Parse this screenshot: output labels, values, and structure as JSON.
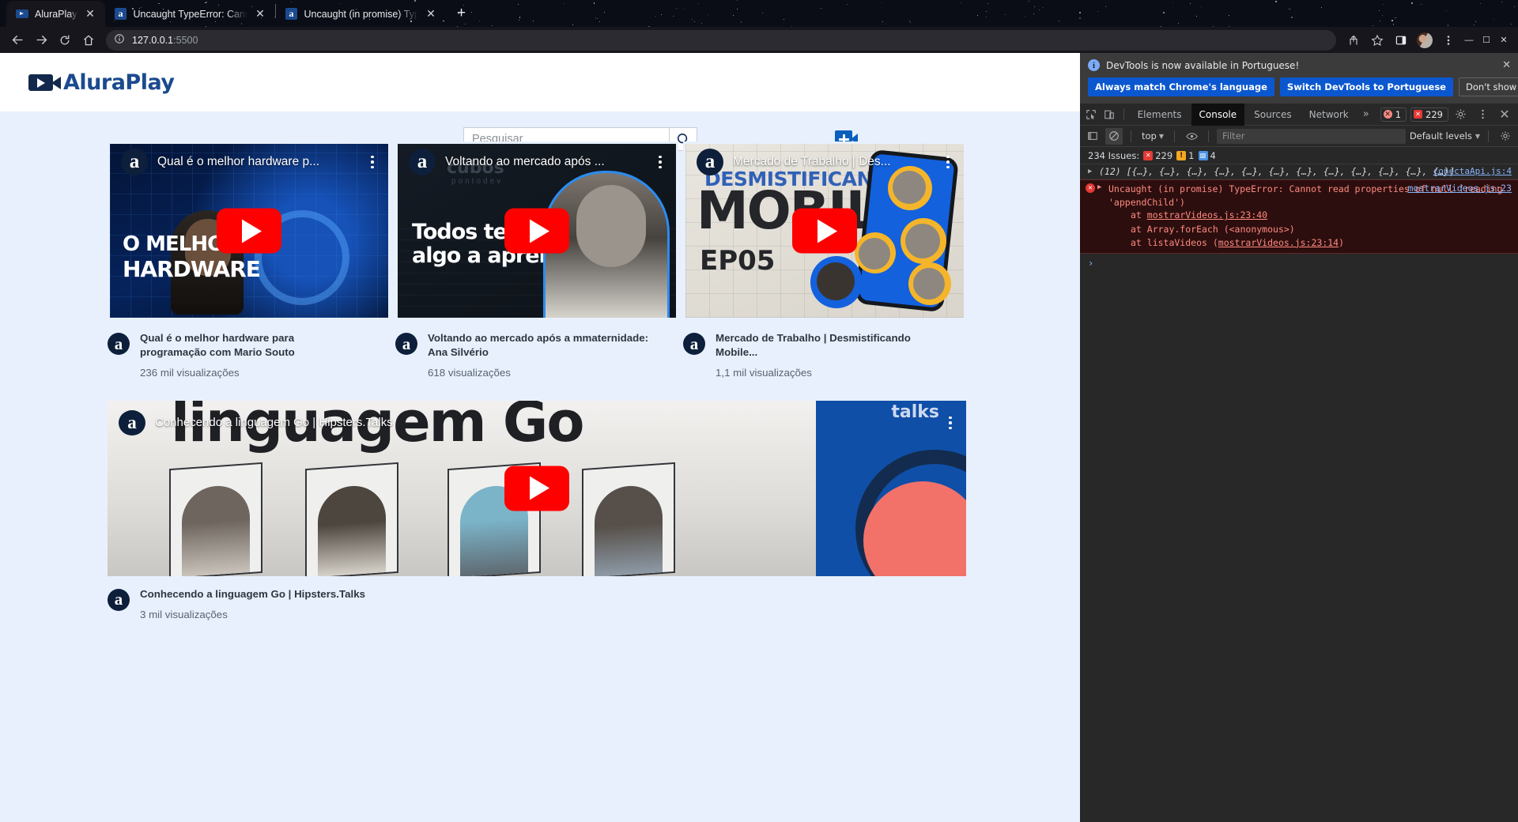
{
  "browser": {
    "tabs": [
      {
        "title": "AluraPlay",
        "favicon": "play-icon",
        "active": true,
        "close_label": "✕"
      },
      {
        "title": "Uncaught TypeError: Cannot read",
        "favicon": "alura-icon",
        "active": false,
        "close_label": "✕"
      },
      {
        "title": "Uncaught (in promise) TypeError:",
        "favicon": "alura-icon",
        "active": false,
        "close_label": "✕"
      }
    ],
    "new_tab_label": "+",
    "nav": {
      "back_icon": "arrow-left-icon",
      "forward_icon": "arrow-right-icon",
      "reload_icon": "reload-icon",
      "home_icon": "home-icon",
      "site_info_icon": "info-circle-icon",
      "url_host": "127.0.0.1",
      "url_port": ":5500",
      "share_icon": "share-icon",
      "bookmark_icon": "star-icon",
      "sidepanel_icon": "side-panel-icon",
      "profile_icon": "avatar",
      "menu_icon": "kebab-menu-icon"
    },
    "window_controls": {
      "minimize": "—",
      "maximize": "☐",
      "close": "✕"
    }
  },
  "site": {
    "logo_text": "AluraPlay",
    "search": {
      "placeholder": "Pesquisar",
      "value": "",
      "button_icon": "search-icon"
    },
    "add_video_icon": "add-video-icon",
    "videos": [
      {
        "overlay_title": "Qual é o melhor hardware p...",
        "title": "Qual é o melhor hardware para programação com Mario Souto",
        "views": "236 mil visualizações",
        "channel_icon": "alura-badge-icon",
        "play_icon": "youtube-play-icon",
        "menu_icon": "kebab-menu-icon",
        "art_text_1": "O MELHOR",
        "art_text_2": "HARDWARE",
        "layout": "grid"
      },
      {
        "overlay_title": "Voltando ao mercado após ...",
        "title": "Voltando ao mercado após a mmaternidade: Ana Silvério",
        "views": "618 visualizações",
        "channel_icon": "alura-badge-icon",
        "play_icon": "youtube-play-icon",
        "menu_icon": "kebab-menu-icon",
        "art_text_1": "Todos temos",
        "art_text_2": "algo a aprender.",
        "art_logo": "cubos",
        "art_sub": "pontodev",
        "layout": "grid"
      },
      {
        "overlay_title": "Mercado de Trabalho | Des...",
        "title": "Mercado de Trabalho | Desmistificando Mobile...",
        "views": "1,1 mil visualizações",
        "channel_icon": "alura-badge-icon",
        "play_icon": "youtube-play-icon",
        "menu_icon": "kebab-menu-icon",
        "art_text_1": "DESMISTIFICANDO",
        "art_text_2": "MOBILE",
        "art_text_3": "EP05",
        "layout": "grid"
      },
      {
        "overlay_title": "Conhecendo a linguagem Go | Hipsters.Talks",
        "title": "Conhecendo a linguagem Go | Hipsters.Talks",
        "views": "3 mil visualizações",
        "channel_icon": "alura-badge-icon",
        "play_icon": "youtube-play-icon",
        "menu_icon": "kebab-menu-icon",
        "art_text_1": "linguagem Go",
        "art_text_2": "talks",
        "layout": "wide"
      }
    ]
  },
  "devtools": {
    "notice": {
      "text": "DevTools is now available in Portuguese!",
      "info_icon": "info-circle-icon",
      "btn_always": "Always match Chrome's language",
      "btn_switch": "Switch DevTools to Portuguese",
      "btn_dismiss": "Don't show again",
      "close_icon": "close-icon"
    },
    "tabs": [
      {
        "label": "Elements",
        "active": false
      },
      {
        "label": "Console",
        "active": true
      },
      {
        "label": "Sources",
        "active": false
      },
      {
        "label": "Network",
        "active": false
      }
    ],
    "tab_overflow": "»",
    "inspect_icon": "inspect-element-icon",
    "device_icon": "device-toolbar-icon",
    "badges": {
      "warning_count": "1",
      "error_count": "229"
    },
    "settings_icon": "gear-icon",
    "more_icon": "kebab-menu-icon",
    "close_icon": "close-icon",
    "filterbar": {
      "sidebar_icon": "console-sidebar-icon",
      "clear_icon": "clear-console-icon",
      "context": "top",
      "eye_icon": "live-expression-icon",
      "filter_placeholder": "Filter",
      "filter_value": "",
      "levels": "Default levels",
      "settings_icon": "gear-icon"
    },
    "issues": {
      "label": "234 Issues:",
      "errors": "229",
      "warnings": "1",
      "info": "4"
    },
    "console": {
      "log_source": "conectaApi.js:4",
      "log_preview": "(12) [{…}, {…}, {…}, {…}, {…}, {…}, {…}, {…}, {…}, {…}, {…}, {…}]",
      "error_message": "Uncaught (in promise) TypeError: Cannot read properties of null (reading 'appendChild')",
      "error_source": "mostrarVideos.js:23",
      "stack": [
        "at mostrarVideos.js:23:40",
        "at Array.forEach (<anonymous>)",
        "at listaVideos (mostrarVideos.js:23:14)"
      ],
      "prompt": "›"
    }
  }
}
